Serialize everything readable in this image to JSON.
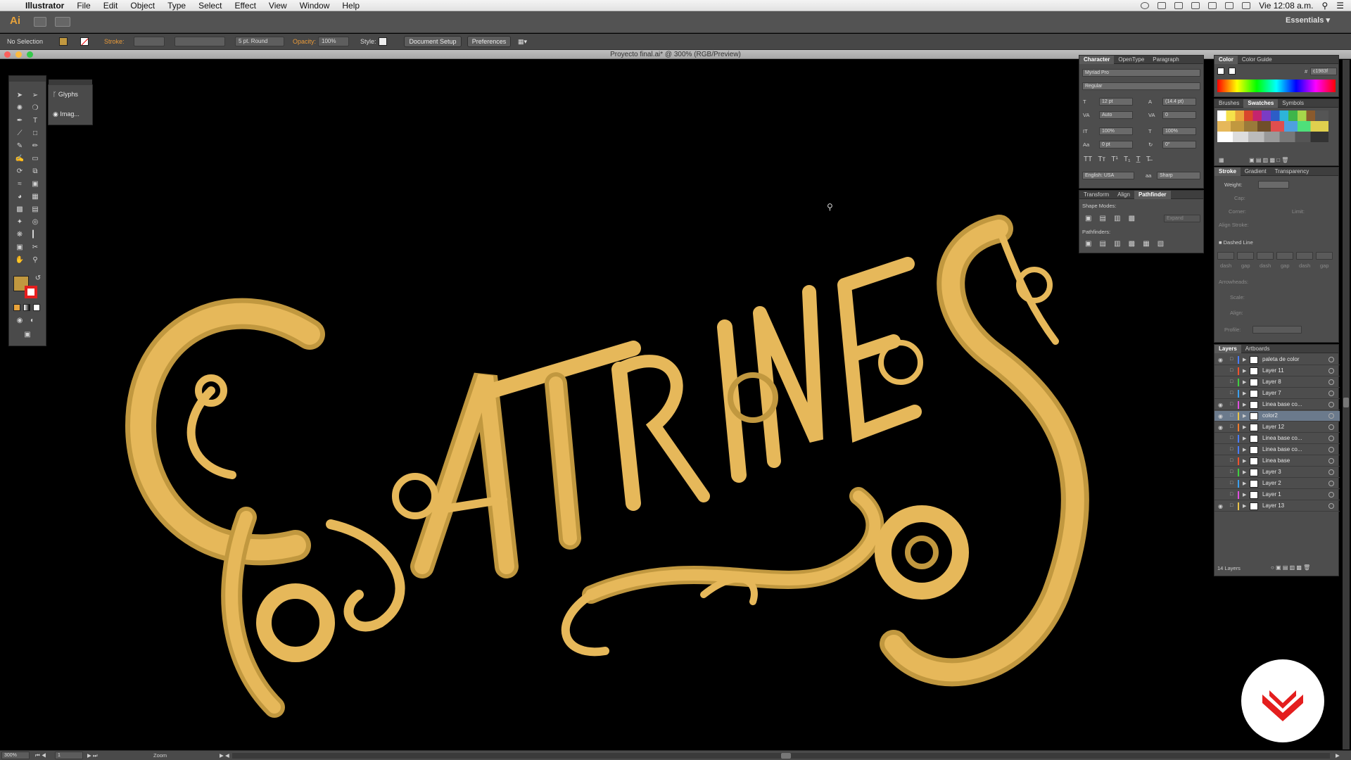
{
  "menubar": {
    "apple": "",
    "app": "Illustrator",
    "items": [
      "File",
      "Edit",
      "Object",
      "Type",
      "Select",
      "Effect",
      "View",
      "Window",
      "Help"
    ],
    "clock": "Vie 12:08 a.m."
  },
  "appbar": {
    "logo": "Ai",
    "workspace": "Essentials"
  },
  "control": {
    "selection": "No Selection",
    "stroke_label": "Stroke:",
    "brush": "5 pt. Round",
    "opacity_label": "Opacity:",
    "opacity": "100%",
    "style_label": "Style:",
    "doc_setup": "Document Setup",
    "preferences": "Preferences"
  },
  "document": {
    "title": "Proyecto final.ai* @ 300% (RGB/Preview)"
  },
  "flyout": {
    "glyphs": "Glyphs",
    "image": "Imag..."
  },
  "character": {
    "tabs": [
      "Character",
      "OpenType",
      "Paragraph"
    ],
    "font": "Myriad Pro",
    "style": "Regular",
    "size": "12 pt",
    "leading": "(14.4 pt)",
    "kerning": "Auto",
    "tracking": "0",
    "vscale": "100%",
    "hscale": "100%",
    "baseline": "0 pt",
    "rotation": "0°",
    "language": "English: USA",
    "aa": "Sharp"
  },
  "transform_panel": {
    "tabs": [
      "Transform",
      "Align",
      "Pathfinder"
    ],
    "shape_modes": "Shape Modes:",
    "expand": "Expand",
    "pathfinders": "Pathfinders:"
  },
  "color_panel": {
    "tabs": [
      "Color",
      "Color Guide"
    ],
    "hex": "c1983f",
    "hash": "#"
  },
  "swatches_panel": {
    "tabs": [
      "Brushes",
      "Swatches",
      "Symbols"
    ]
  },
  "stroke_panel": {
    "tabs": [
      "Stroke",
      "Gradient",
      "Transparency"
    ],
    "weight": "Weight:",
    "cap": "Cap:",
    "corner": "Corner:",
    "limit": "Limit:",
    "align": "Align Stroke:",
    "dashed": "Dashed Line",
    "dash_labels": [
      "dash",
      "gap",
      "dash",
      "gap",
      "dash",
      "gap"
    ],
    "arrowheads": "Arrowheads:",
    "scale": "Scale:",
    "align2": "Align:",
    "profile": "Profile:"
  },
  "layers_panel": {
    "tabs": [
      "Layers",
      "Artboards"
    ],
    "count": "14 Layers",
    "layers": [
      {
        "name": "paleta de color",
        "eye": true,
        "color": "#4a7cf7"
      },
      {
        "name": "Layer 11",
        "eye": false,
        "color": "#f0522d"
      },
      {
        "name": "Layer 8",
        "eye": false,
        "color": "#3ed23e"
      },
      {
        "name": "Layer 7",
        "eye": false,
        "color": "#3aa0f0"
      },
      {
        "name": "Linea base co...",
        "eye": true,
        "color": "#e04ee0"
      },
      {
        "name": "color2",
        "eye": true,
        "color": "#e8c24a",
        "selected": true
      },
      {
        "name": "Layer 12",
        "eye": true,
        "color": "#f07a2d"
      },
      {
        "name": "Linea base co...",
        "eye": false,
        "color": "#4a7cf7"
      },
      {
        "name": "Linea base co...",
        "eye": false,
        "color": "#4a7cf7"
      },
      {
        "name": "Linea base",
        "eye": false,
        "color": "#f0522d"
      },
      {
        "name": "Layer 3",
        "eye": false,
        "color": "#3ed23e"
      },
      {
        "name": "Layer 2",
        "eye": false,
        "color": "#3aa0f0"
      },
      {
        "name": "Layer 1",
        "eye": false,
        "color": "#e04ee0"
      },
      {
        "name": "Layer 13",
        "eye": true,
        "color": "#e8c24a"
      }
    ]
  },
  "status": {
    "zoom": "300%",
    "page": "1",
    "tool": "Zoom"
  },
  "artwork": {
    "label": "CATRINES",
    "gold": "#e6b85a",
    "gold_dark": "#c1983f"
  }
}
